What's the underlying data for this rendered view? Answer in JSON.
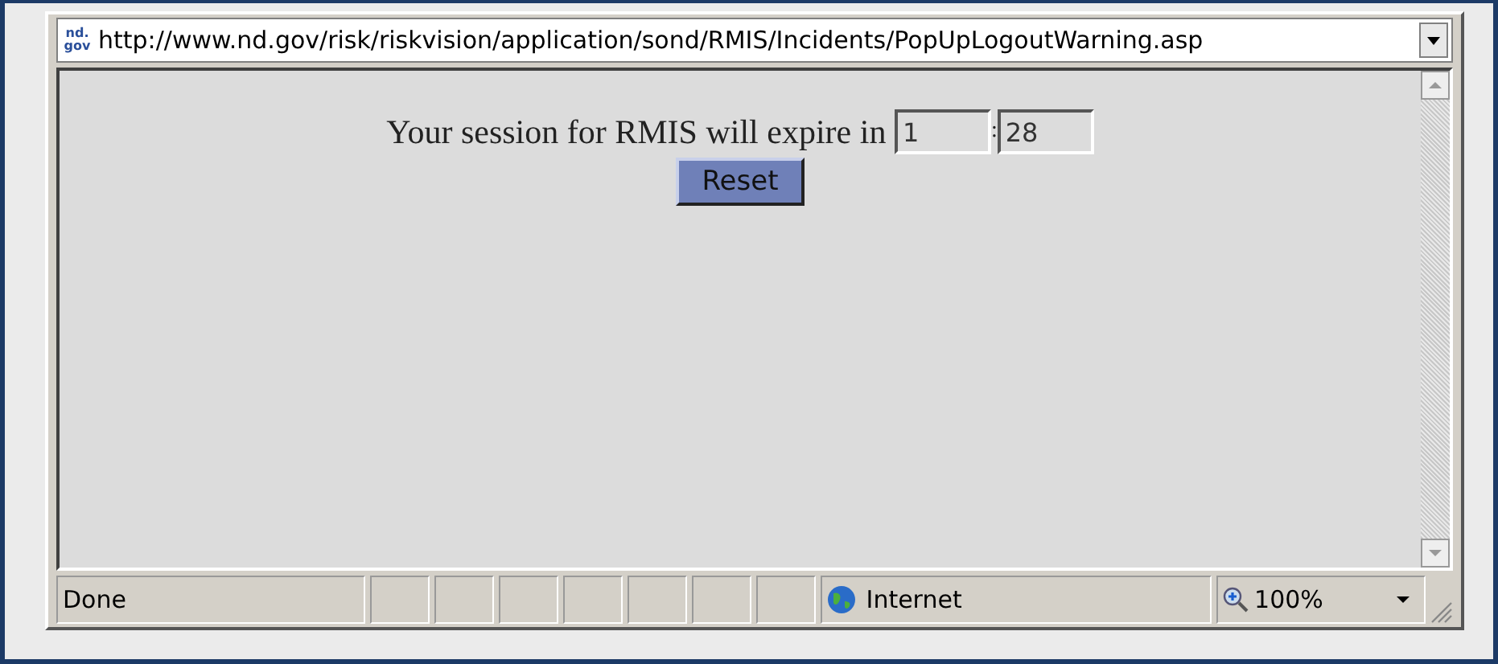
{
  "address_bar": {
    "url": "http://www.nd.gov/risk/riskvision/application/sond/RMIS/Incidents/PopUpLogoutWarning.asp",
    "favicon": "nd.gov"
  },
  "content": {
    "message": "Your session for RMIS will expire in",
    "minutes": "1",
    "separator": ":",
    "seconds": "28",
    "reset_button": "Reset"
  },
  "status_bar": {
    "status": "Done",
    "zone": "Internet",
    "zoom": "100%"
  }
}
